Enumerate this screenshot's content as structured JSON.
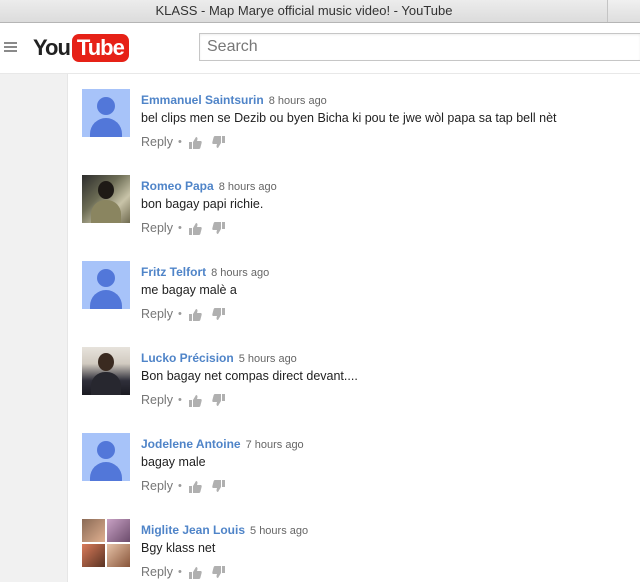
{
  "window": {
    "title": "KLASS - Map Marye official music video! - YouTube"
  },
  "header": {
    "logo_you": "You",
    "logo_tube": "Tube",
    "search_placeholder": "Search"
  },
  "comments": [
    {
      "author": "Emmanuel Saintsurin",
      "time": "8 hours ago",
      "text": "bel clips men se Dezib ou byen Bicha ki pou te jwe wòl papa sa tap bell nèt",
      "reply": "Reply",
      "avatar": "default"
    },
    {
      "author": "Romeo Papa",
      "time": "8 hours ago",
      "text": "bon bagay papi richie.",
      "reply": "Reply",
      "avatar": "photo"
    },
    {
      "author": "Fritz Telfort",
      "time": "8 hours ago",
      "text": "me bagay malè a",
      "reply": "Reply",
      "avatar": "default"
    },
    {
      "author": "Lucko Précision",
      "time": "5 hours ago",
      "text": "Bon bagay net compas direct devant....",
      "reply": "Reply",
      "avatar": "photo"
    },
    {
      "author": "Jodelene Antoine",
      "time": "7 hours ago",
      "text": "bagay male",
      "reply": "Reply",
      "avatar": "default"
    },
    {
      "author": "Miglite Jean Louis",
      "time": "5 hours ago",
      "text": "Bgy klass net",
      "reply": "Reply",
      "avatar": "photo"
    }
  ],
  "colors": {
    "author_link": "#4f84c8",
    "logo_red": "#e62117",
    "default_avatar_bg": "#a7c3f9",
    "default_avatar_fg": "#5277d9"
  },
  "icons": {
    "menu": "hamburger-menu-icon",
    "like": "thumbs-up-icon",
    "dislike": "thumbs-down-icon"
  }
}
